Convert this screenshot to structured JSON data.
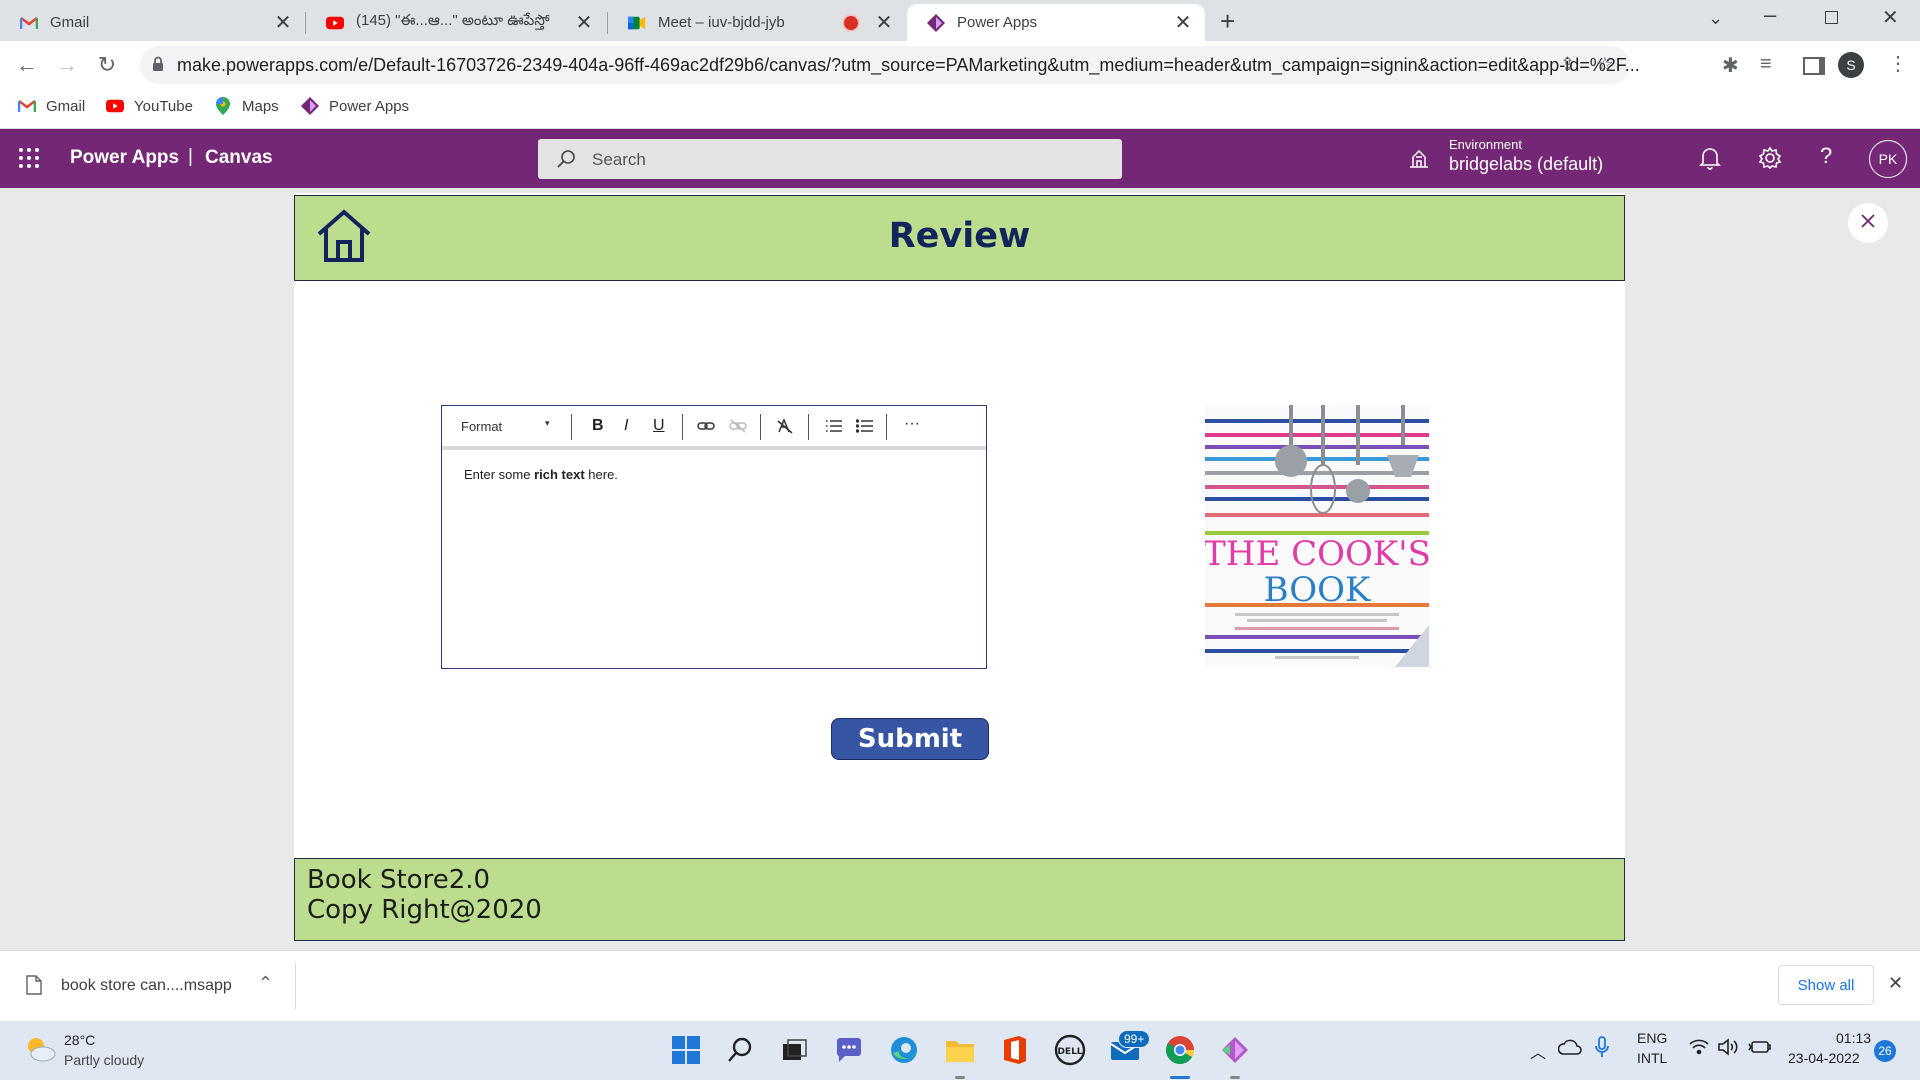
{
  "browser": {
    "tabs": [
      {
        "title": "Gmail",
        "icon": "gmail-icon"
      },
      {
        "title": "(145) \"ఈ...ఆ...\" అంటూ ఊపేస్తో",
        "icon": "youtube-icon"
      },
      {
        "title": "Meet – iuv-bjdd-jyb",
        "icon": "meet-icon"
      },
      {
        "title": "Power Apps",
        "icon": "powerapps-icon"
      }
    ],
    "url": "make.powerapps.com/e/Default-16703726-2349-404a-96ff-469ac2df29b6/canvas/?utm_source=PAMarketing&utm_medium=header&utm_campaign=signin&action=edit&app-id=%2F...",
    "profile_initial": "S",
    "bookmarks": [
      {
        "label": "Gmail",
        "icon": "gmail-icon"
      },
      {
        "label": "YouTube",
        "icon": "youtube-icon"
      },
      {
        "label": "Maps",
        "icon": "maps-icon"
      },
      {
        "label": "Power Apps",
        "icon": "powerapps-icon"
      }
    ]
  },
  "powerapps": {
    "brand": "Power Apps",
    "separator": "|",
    "section": "Canvas",
    "search_placeholder": "Search",
    "environment_label": "Environment",
    "environment_value": "bridgelabs (default)",
    "user_initials": "PK"
  },
  "app": {
    "header_title": "Review",
    "rte": {
      "format_label": "Format",
      "bold_label": "B",
      "italic_label": "I",
      "underline_label": "U",
      "more_label": "···",
      "text_prefix": "Enter some ",
      "text_bold": "rich text",
      "text_suffix": " here."
    },
    "book": {
      "title_line1": "THE COOK'S",
      "title_line2": "BOOK"
    },
    "submit_label": "Submit",
    "footer_line1": "Book Store2.0",
    "footer_line2": "Copy Right@2020"
  },
  "download": {
    "filename": "book store can....msapp",
    "show_all": "Show all"
  },
  "taskbar": {
    "temperature": "28°C",
    "weather": "Partly cloudy",
    "mail_badge": "99+",
    "lang_line1": "ENG",
    "lang_line2": "INTL",
    "time": "01:13",
    "date": "23-04-2022",
    "notifications": "26"
  },
  "colors": {
    "powerapps_purple": "#742774",
    "band_green": "#bbdd8d",
    "submit_blue": "#3655a3",
    "title_navy": "#13235b"
  }
}
